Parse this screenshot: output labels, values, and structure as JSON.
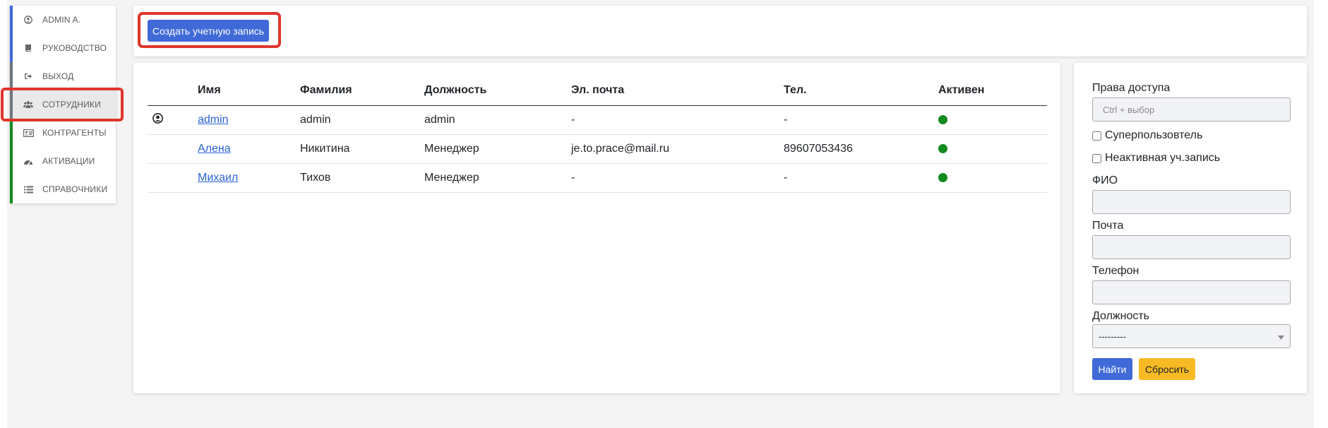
{
  "sidebar": {
    "items": [
      {
        "label": "ADMIN A.",
        "icon": "user-circle-icon",
        "accent": "#3f6ad8"
      },
      {
        "label": "РУКОВОДСТВО",
        "icon": "book-icon",
        "accent": "#3f6ad8"
      },
      {
        "label": "ВЫХОД",
        "icon": "sign-out-icon",
        "accent": "#6c757d"
      },
      {
        "label": "СОТРУДНИКИ",
        "icon": "users-icon",
        "accent": "#6c757d"
      },
      {
        "label": "КОНТРАГЕНТЫ",
        "icon": "address-card-icon",
        "accent": "#128b1e"
      },
      {
        "label": "АКТИВАЦИИ",
        "icon": "dashboard-icon",
        "accent": "#128b1e"
      },
      {
        "label": "СПРАВОЧНИКИ",
        "icon": "list-icon",
        "accent": "#128b1e"
      }
    ],
    "active_index": 3
  },
  "toolbar": {
    "create_label": "Создать учетную запись"
  },
  "table": {
    "headers": [
      "Имя",
      "Фамилия",
      "Должность",
      "Эл. почта",
      "Тел.",
      "Активен"
    ],
    "rows": [
      {
        "first": "admin",
        "last": "admin",
        "position": "admin",
        "email": "-",
        "phone": "-",
        "active": true,
        "current_user": true
      },
      {
        "first": "Алена",
        "last": "Никитина",
        "position": "Менеджер",
        "email": "je.to.prace@mail.ru",
        "phone": "89607053436",
        "active": true,
        "current_user": false
      },
      {
        "first": "Михаил",
        "last": "Тихов",
        "position": "Менеджер",
        "email": "-",
        "phone": "-",
        "active": true,
        "current_user": false
      }
    ]
  },
  "filters": {
    "access_label": "Права доступа",
    "access_placeholder": "Ctrl + выбор",
    "superuser_label": "Суперпользовтель",
    "inactive_label": "Неактивная уч.запись",
    "fio_label": "ФИО",
    "mail_label": "Почта",
    "phone_label": "Телефон",
    "position_label": "Должность",
    "position_selected": "---------",
    "find_label": "Найти",
    "reset_label": "Сбросить"
  },
  "colors": {
    "primary": "#3f6ad8",
    "warning": "#f7b924",
    "success": "#128b1e",
    "highlight": "#e0352b"
  }
}
